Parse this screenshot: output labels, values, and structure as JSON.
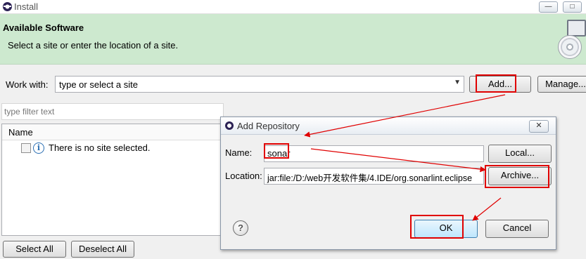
{
  "window": {
    "title": "Install",
    "minimize_glyph": "—",
    "maximize_glyph": "□"
  },
  "header": {
    "title": "Available Software",
    "description": "Select a site or enter the location of a site."
  },
  "work_with": {
    "label": "Work with:",
    "combo_value": "type or select a site",
    "add_label": "Add...",
    "manage_label": "Manage..."
  },
  "filter": {
    "placeholder": "type filter text"
  },
  "table": {
    "columns": [
      "Name"
    ],
    "rows": [
      {
        "checked": false,
        "text": "There is no site selected."
      }
    ]
  },
  "footer": {
    "select_all_label": "Select All",
    "deselect_all_label": "Deselect All"
  },
  "dialog": {
    "title": "Add Repository",
    "close_glyph": "✕",
    "name_label": "Name:",
    "name_value": "sonar",
    "local_label": "Local...",
    "location_label": "Location:",
    "location_value": "jar:file:/D:/web开发软件集/4.IDE/org.sonarlint.eclipse",
    "archive_label": "Archive...",
    "ok_label": "OK",
    "cancel_label": "Cancel",
    "help_glyph": "?"
  },
  "icons": {
    "app": "eclipse-icon",
    "info": "info-icon",
    "help": "help-icon",
    "cd": "cd-icon"
  },
  "colors": {
    "header_bg": "#cde9cf",
    "annotation": "#e00000"
  }
}
